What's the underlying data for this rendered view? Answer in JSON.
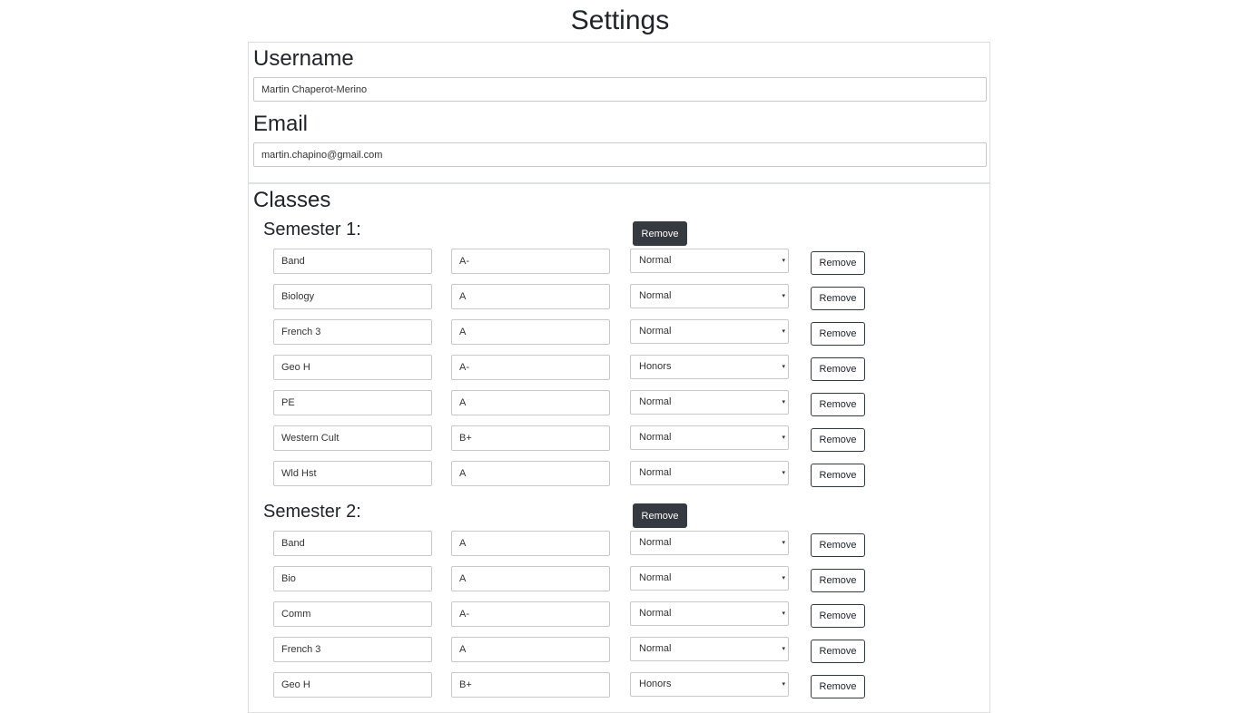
{
  "page": {
    "title": "Settings"
  },
  "username": {
    "label": "Username",
    "value": "Martin Chaperot-Merino"
  },
  "email": {
    "label": "Email",
    "value": "martin.chapino@gmail.com"
  },
  "classes": {
    "label": "Classes",
    "semesters": [
      {
        "title": "Semester 1:",
        "remove_label": "Remove",
        "rows": [
          {
            "name": "Band",
            "grade": "A-",
            "level": "Normal",
            "remove_label": "Remove"
          },
          {
            "name": "Biology",
            "grade": "A",
            "level": "Normal",
            "remove_label": "Remove"
          },
          {
            "name": "French 3",
            "grade": "A",
            "level": "Normal",
            "remove_label": "Remove"
          },
          {
            "name": "Geo H",
            "grade": "A-",
            "level": "Honors",
            "remove_label": "Remove"
          },
          {
            "name": "PE",
            "grade": "A",
            "level": "Normal",
            "remove_label": "Remove"
          },
          {
            "name": "Western Cult",
            "grade": "B+",
            "level": "Normal",
            "remove_label": "Remove"
          },
          {
            "name": "Wld Hst",
            "grade": "A",
            "level": "Normal",
            "remove_label": "Remove"
          }
        ]
      },
      {
        "title": "Semester 2:",
        "remove_label": "Remove",
        "rows": [
          {
            "name": "Band",
            "grade": "A",
            "level": "Normal",
            "remove_label": "Remove"
          },
          {
            "name": "Bio",
            "grade": "A",
            "level": "Normal",
            "remove_label": "Remove"
          },
          {
            "name": "Comm",
            "grade": "A-",
            "level": "Normal",
            "remove_label": "Remove"
          },
          {
            "name": "French 3",
            "grade": "A",
            "level": "Normal",
            "remove_label": "Remove"
          },
          {
            "name": "Geo H",
            "grade": "B+",
            "level": "Honors",
            "remove_label": "Remove"
          }
        ]
      }
    ]
  },
  "icons": {
    "select_arrow": "dropdown-arrow-icon"
  }
}
